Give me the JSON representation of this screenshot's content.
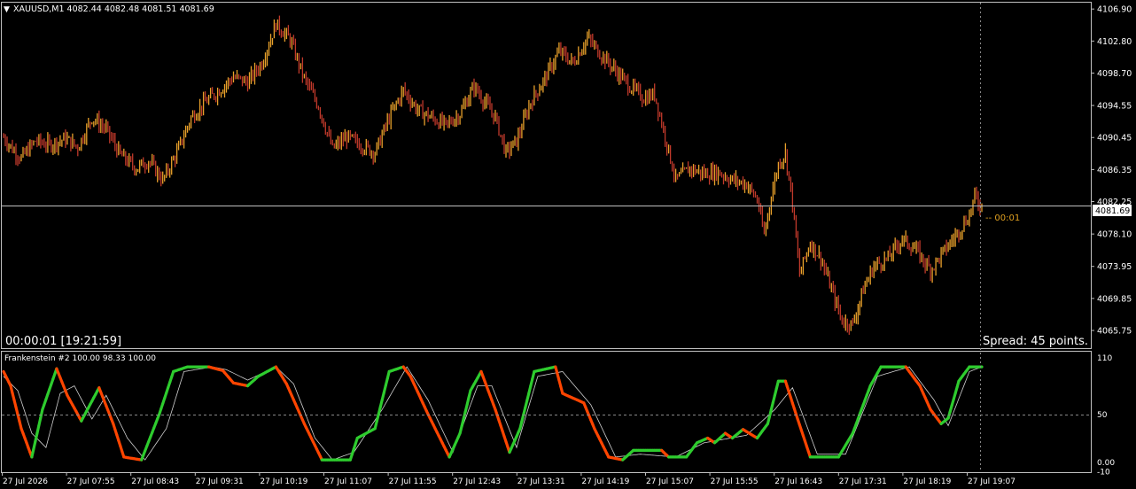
{
  "symbol_header": {
    "arrow": "▼",
    "text": "XAUUSD,M1  4082.44 4082.48 4081.51 4081.69"
  },
  "timer_text": "00:00:01 [19:21:59]",
  "spread_text": "Spread: 45 points.",
  "countdown_text": "-- 00:01",
  "indicator_header": "Frankenstein #2 100.00 98.33 100.00",
  "colors": {
    "background": "#000000",
    "frame": "#c0c0c0",
    "candle_up": "#e8a02a",
    "candle_down": "#c0392b",
    "osc_up": "#2ecc2e",
    "osc_down": "#ff4500",
    "signal": "#d0d0d0",
    "countdown": "#e0a020",
    "price_tag_bg": "#ffffff",
    "price_tag_text": "#000000"
  },
  "chart_data": [
    {
      "type": "candlestick",
      "title": "XAUUSD,M1",
      "ylim": [
        4063.6,
        4107.6
      ],
      "y_ticks": [
        "4106.90",
        "4102.80",
        "4098.70",
        "4094.55",
        "4090.45",
        "4086.35",
        "4082.25",
        "4078.10",
        "4073.95",
        "4069.85",
        "4065.75"
      ],
      "current_price": "4081.69",
      "x_ticks": [
        "27 Jul 2026",
        "27 Jul 07:55",
        "27 Jul 08:43",
        "27 Jul 09:31",
        "27 Jul 10:19",
        "27 Jul 11:07",
        "27 Jul 11:55",
        "27 Jul 12:43",
        "27 Jul 13:31",
        "27 Jul 14:19",
        "27 Jul 15:07",
        "27 Jul 15:55",
        "27 Jul 16:43",
        "27 Jul 17:31",
        "27 Jul 18:19",
        "27 Jul 19:07"
      ],
      "close_path": [
        {
          "t": 0,
          "p": 4090.5
        },
        {
          "t": 5,
          "p": 4089.0
        },
        {
          "t": 10,
          "p": 4087.8
        },
        {
          "t": 18,
          "p": 4090.0
        },
        {
          "t": 26,
          "p": 4089.5
        },
        {
          "t": 35,
          "p": 4090.3
        },
        {
          "t": 42,
          "p": 4089.2
        },
        {
          "t": 50,
          "p": 4093.0
        },
        {
          "t": 58,
          "p": 4091.5
        },
        {
          "t": 66,
          "p": 4088.2
        },
        {
          "t": 75,
          "p": 4086.5
        },
        {
          "t": 82,
          "p": 4087.5
        },
        {
          "t": 90,
          "p": 4085.0
        },
        {
          "t": 98,
          "p": 4088.5
        },
        {
          "t": 106,
          "p": 4093.0
        },
        {
          "t": 114,
          "p": 4095.0
        },
        {
          "t": 122,
          "p": 4096.5
        },
        {
          "t": 130,
          "p": 4098.2
        },
        {
          "t": 138,
          "p": 4097.5
        },
        {
          "t": 146,
          "p": 4100.0
        },
        {
          "t": 154,
          "p": 4105.0
        },
        {
          "t": 162,
          "p": 4103.0
        },
        {
          "t": 170,
          "p": 4098.0
        },
        {
          "t": 178,
          "p": 4094.5
        },
        {
          "t": 186,
          "p": 4089.0
        },
        {
          "t": 194,
          "p": 4090.5
        },
        {
          "t": 202,
          "p": 4089.5
        },
        {
          "t": 210,
          "p": 4088.5
        },
        {
          "t": 218,
          "p": 4093.0
        },
        {
          "t": 226,
          "p": 4096.5
        },
        {
          "t": 234,
          "p": 4094.0
        },
        {
          "t": 242,
          "p": 4093.0
        },
        {
          "t": 250,
          "p": 4092.0
        },
        {
          "t": 258,
          "p": 4093.5
        },
        {
          "t": 266,
          "p": 4097.0
        },
        {
          "t": 272,
          "p": 4095.0
        },
        {
          "t": 278,
          "p": 4093.0
        },
        {
          "t": 284,
          "p": 4088.5
        },
        {
          "t": 290,
          "p": 4090.0
        },
        {
          "t": 298,
          "p": 4095.0
        },
        {
          "t": 306,
          "p": 4098.0
        },
        {
          "t": 314,
          "p": 4101.5
        },
        {
          "t": 322,
          "p": 4100.0
        },
        {
          "t": 330,
          "p": 4103.2
        },
        {
          "t": 338,
          "p": 4101.0
        },
        {
          "t": 346,
          "p": 4099.0
        },
        {
          "t": 354,
          "p": 4097.0
        },
        {
          "t": 362,
          "p": 4095.5
        },
        {
          "t": 368,
          "p": 4096.0
        },
        {
          "t": 374,
          "p": 4090.5
        },
        {
          "t": 380,
          "p": 4085.0
        },
        {
          "t": 388,
          "p": 4086.5
        },
        {
          "t": 396,
          "p": 4085.8
        },
        {
          "t": 404,
          "p": 4086.0
        },
        {
          "t": 412,
          "p": 4085.0
        },
        {
          "t": 420,
          "p": 4084.5
        },
        {
          "t": 426,
          "p": 4082.5
        },
        {
          "t": 430,
          "p": 4078.0
        },
        {
          "t": 434,
          "p": 4083.0
        },
        {
          "t": 438,
          "p": 4087.0
        },
        {
          "t": 442,
          "p": 4088.5
        },
        {
          "t": 446,
          "p": 4082.0
        },
        {
          "t": 450,
          "p": 4073.0
        },
        {
          "t": 456,
          "p": 4077.0
        },
        {
          "t": 462,
          "p": 4075.0
        },
        {
          "t": 468,
          "p": 4071.0
        },
        {
          "t": 474,
          "p": 4067.0
        },
        {
          "t": 480,
          "p": 4066.5
        },
        {
          "t": 486,
          "p": 4071.0
        },
        {
          "t": 492,
          "p": 4074.0
        },
        {
          "t": 500,
          "p": 4075.0
        },
        {
          "t": 508,
          "p": 4077.5
        },
        {
          "t": 516,
          "p": 4076.0
        },
        {
          "t": 524,
          "p": 4073.5
        },
        {
          "t": 532,
          "p": 4076.0
        },
        {
          "t": 540,
          "p": 4078.5
        },
        {
          "t": 546,
          "p": 4080.5
        },
        {
          "t": 549,
          "p": 4083.0
        },
        {
          "t": 551,
          "p": 4082.0
        },
        {
          "t": 553,
          "p": 4081.69
        }
      ]
    },
    {
      "type": "line",
      "title": "Frankenstein #2",
      "ylim": [
        -10,
        115
      ],
      "y_ticks": [
        "110",
        "50",
        "0.00",
        "-10"
      ],
      "level": 50,
      "series": [
        {
          "role": "main",
          "values": [
            {
              "t": 0,
              "v": 95
            },
            {
              "t": 4,
              "v": 80
            },
            {
              "t": 10,
              "v": 35
            },
            {
              "t": 16,
              "v": 5
            },
            {
              "t": 22,
              "v": 55
            },
            {
              "t": 30,
              "v": 98
            },
            {
              "t": 36,
              "v": 70
            },
            {
              "t": 44,
              "v": 43
            },
            {
              "t": 54,
              "v": 78
            },
            {
              "t": 62,
              "v": 40
            },
            {
              "t": 68,
              "v": 5
            },
            {
              "t": 78,
              "v": 2
            },
            {
              "t": 88,
              "v": 50
            },
            {
              "t": 96,
              "v": 95
            },
            {
              "t": 104,
              "v": 100
            },
            {
              "t": 116,
              "v": 100
            },
            {
              "t": 124,
              "v": 96
            },
            {
              "t": 130,
              "v": 83
            },
            {
              "t": 138,
              "v": 80
            },
            {
              "t": 144,
              "v": 90
            },
            {
              "t": 154,
              "v": 100
            },
            {
              "t": 160,
              "v": 82
            },
            {
              "t": 170,
              "v": 40
            },
            {
              "t": 180,
              "v": 2
            },
            {
              "t": 196,
              "v": 2
            },
            {
              "t": 200,
              "v": 25
            },
            {
              "t": 210,
              "v": 35
            },
            {
              "t": 218,
              "v": 95
            },
            {
              "t": 226,
              "v": 100
            },
            {
              "t": 230,
              "v": 90
            },
            {
              "t": 240,
              "v": 50
            },
            {
              "t": 252,
              "v": 5
            },
            {
              "t": 258,
              "v": 30
            },
            {
              "t": 264,
              "v": 75
            },
            {
              "t": 270,
              "v": 95
            },
            {
              "t": 278,
              "v": 55
            },
            {
              "t": 286,
              "v": 10
            },
            {
              "t": 292,
              "v": 35
            },
            {
              "t": 300,
              "v": 95
            },
            {
              "t": 312,
              "v": 100
            },
            {
              "t": 316,
              "v": 72
            },
            {
              "t": 328,
              "v": 62
            },
            {
              "t": 334,
              "v": 35
            },
            {
              "t": 342,
              "v": 5
            },
            {
              "t": 350,
              "v": 2
            },
            {
              "t": 356,
              "v": 12
            },
            {
              "t": 372,
              "v": 12
            },
            {
              "t": 376,
              "v": 5
            },
            {
              "t": 386,
              "v": 5
            },
            {
              "t": 392,
              "v": 20
            },
            {
              "t": 398,
              "v": 25
            },
            {
              "t": 402,
              "v": 20
            },
            {
              "t": 408,
              "v": 30
            },
            {
              "t": 412,
              "v": 25
            },
            {
              "t": 418,
              "v": 34
            },
            {
              "t": 426,
              "v": 25
            },
            {
              "t": 432,
              "v": 40
            },
            {
              "t": 438,
              "v": 85
            },
            {
              "t": 442,
              "v": 85
            },
            {
              "t": 448,
              "v": 50
            },
            {
              "t": 456,
              "v": 5
            },
            {
              "t": 472,
              "v": 5
            },
            {
              "t": 480,
              "v": 30
            },
            {
              "t": 490,
              "v": 80
            },
            {
              "t": 496,
              "v": 100
            },
            {
              "t": 510,
              "v": 100
            },
            {
              "t": 518,
              "v": 80
            },
            {
              "t": 524,
              "v": 55
            },
            {
              "t": 530,
              "v": 40
            },
            {
              "t": 534,
              "v": 46
            },
            {
              "t": 540,
              "v": 85
            },
            {
              "t": 546,
              "v": 100
            },
            {
              "t": 553,
              "v": 100
            }
          ]
        },
        {
          "role": "signal",
          "values": [
            {
              "t": 0,
              "v": 90
            },
            {
              "t": 8,
              "v": 75
            },
            {
              "t": 16,
              "v": 30
            },
            {
              "t": 24,
              "v": 15
            },
            {
              "t": 32,
              "v": 72
            },
            {
              "t": 40,
              "v": 80
            },
            {
              "t": 50,
              "v": 45
            },
            {
              "t": 58,
              "v": 70
            },
            {
              "t": 70,
              "v": 25
            },
            {
              "t": 80,
              "v": 2
            },
            {
              "t": 92,
              "v": 35
            },
            {
              "t": 102,
              "v": 95
            },
            {
              "t": 118,
              "v": 100
            },
            {
              "t": 126,
              "v": 97
            },
            {
              "t": 138,
              "v": 86
            },
            {
              "t": 154,
              "v": 100
            },
            {
              "t": 164,
              "v": 82
            },
            {
              "t": 176,
              "v": 25
            },
            {
              "t": 186,
              "v": 2
            },
            {
              "t": 198,
              "v": 10
            },
            {
              "t": 214,
              "v": 55
            },
            {
              "t": 228,
              "v": 100
            },
            {
              "t": 240,
              "v": 65
            },
            {
              "t": 254,
              "v": 10
            },
            {
              "t": 268,
              "v": 80
            },
            {
              "t": 276,
              "v": 80
            },
            {
              "t": 290,
              "v": 15
            },
            {
              "t": 302,
              "v": 90
            },
            {
              "t": 316,
              "v": 95
            },
            {
              "t": 332,
              "v": 60
            },
            {
              "t": 346,
              "v": 5
            },
            {
              "t": 360,
              "v": 8
            },
            {
              "t": 380,
              "v": 5
            },
            {
              "t": 396,
              "v": 20
            },
            {
              "t": 420,
              "v": 28
            },
            {
              "t": 436,
              "v": 55
            },
            {
              "t": 446,
              "v": 78
            },
            {
              "t": 460,
              "v": 8
            },
            {
              "t": 476,
              "v": 8
            },
            {
              "t": 494,
              "v": 90
            },
            {
              "t": 512,
              "v": 100
            },
            {
              "t": 526,
              "v": 65
            },
            {
              "t": 534,
              "v": 38
            },
            {
              "t": 546,
              "v": 95
            },
            {
              "t": 553,
              "v": 100
            }
          ]
        }
      ]
    }
  ]
}
